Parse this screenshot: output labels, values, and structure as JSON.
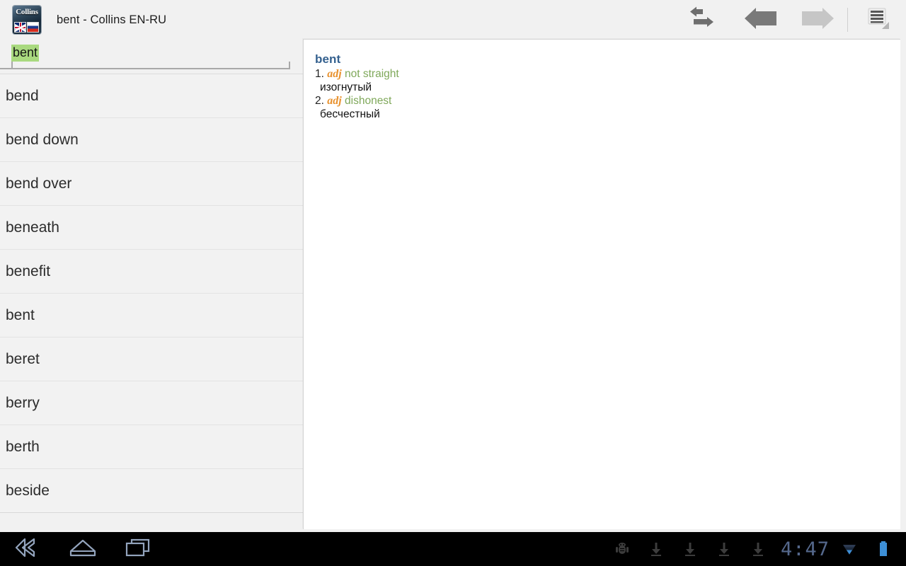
{
  "window": {
    "title": "bent - Collins EN-RU",
    "app_icon_label": "Collins",
    "app_icon_name": "collins-dictionary-icon"
  },
  "toolbar": {
    "buttons": [
      {
        "name": "swap-languages-button",
        "icon": "swap-arrows-icon",
        "state": "enabled"
      },
      {
        "name": "back-button",
        "icon": "arrow-left-icon",
        "state": "enabled"
      },
      {
        "name": "forward-button",
        "icon": "arrow-right-icon",
        "state": "disabled"
      },
      {
        "name": "overflow-menu-button",
        "icon": "menu-list-icon",
        "state": "enabled"
      }
    ]
  },
  "search": {
    "value": "bent",
    "placeholder": "",
    "selection_color": "#a9d97f"
  },
  "word_list": {
    "items": [
      {
        "label": "bend"
      },
      {
        "label": "bend down"
      },
      {
        "label": "bend over"
      },
      {
        "label": "beneath"
      },
      {
        "label": "benefit"
      },
      {
        "label": "bent"
      },
      {
        "label": "beret"
      },
      {
        "label": "berry"
      },
      {
        "label": "berth"
      },
      {
        "label": "beside"
      }
    ]
  },
  "definition": {
    "headword": "bent",
    "headword_color": "#35618f",
    "pos_color": "#e8912d",
    "gloss_color": "#7fa85a",
    "senses": [
      {
        "num": "1.",
        "pos": "adj",
        "gloss": "not straight",
        "translation": "изогнутый"
      },
      {
        "num": "2.",
        "pos": "adj",
        "gloss": "dishonest",
        "translation": "бесчестный"
      }
    ]
  },
  "system_bar": {
    "nav": [
      {
        "name": "android-back-button",
        "icon": "back-chevron-icon"
      },
      {
        "name": "android-home-button",
        "icon": "home-icon"
      },
      {
        "name": "android-recents-button",
        "icon": "recents-icon"
      }
    ],
    "status_icons": [
      {
        "name": "android-debug-icon",
        "icon": "android-bug-icon"
      },
      {
        "name": "download-icon-1",
        "icon": "download-arrow-icon"
      },
      {
        "name": "download-icon-2",
        "icon": "download-arrow-icon"
      },
      {
        "name": "download-icon-3",
        "icon": "download-arrow-icon"
      },
      {
        "name": "download-icon-4",
        "icon": "download-arrow-icon"
      }
    ],
    "clock": "4:47",
    "wifi_icon": "wifi-triangle-icon",
    "battery_icon": "battery-full-icon",
    "accent_color": "#55688c",
    "battery_color": "#3d8fd6"
  }
}
